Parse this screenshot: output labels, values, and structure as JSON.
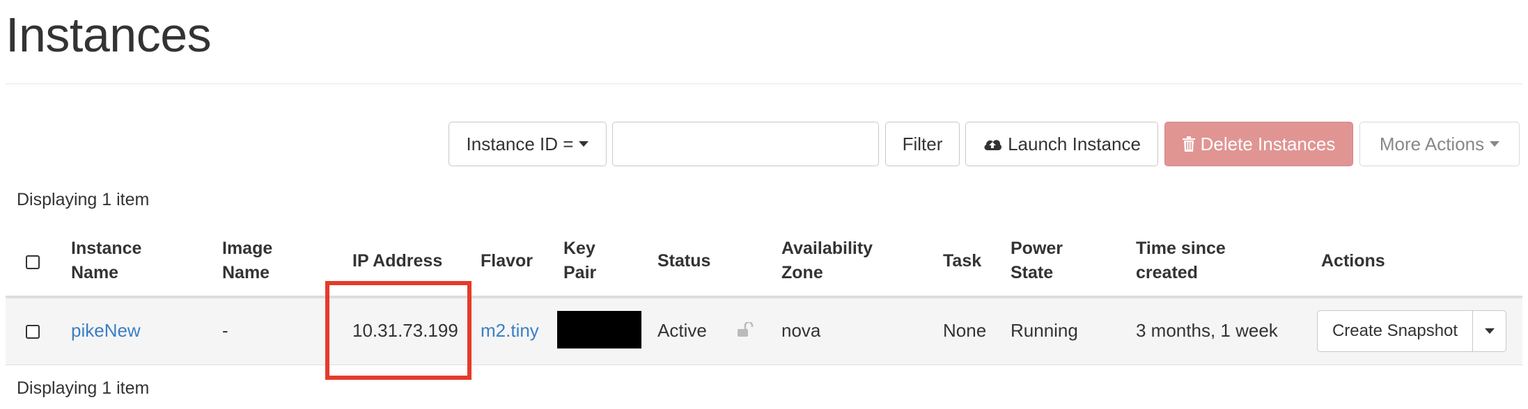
{
  "page": {
    "title": "Instances"
  },
  "toolbar": {
    "filter_field": "Instance ID =",
    "filter_value": "",
    "filter_label": "Filter",
    "launch_label": "Launch Instance",
    "delete_label": "Delete Instances",
    "more_label": "More Actions"
  },
  "summary": {
    "top": "Displaying 1 item",
    "bottom": "Displaying 1 item"
  },
  "table": {
    "headers": {
      "name_line1": "Instance",
      "name_line2": "Name",
      "image_line1": "Image",
      "image_line2": "Name",
      "ip": "IP Address",
      "flavor": "Flavor",
      "keypair_line1": "Key",
      "keypair_line2": "Pair",
      "status": "Status",
      "zone_line1": "Availability",
      "zone_line2": "Zone",
      "task": "Task",
      "power_line1": "Power",
      "power_line2": "State",
      "time_line1": "Time since",
      "time_line2": "created",
      "actions": "Actions"
    },
    "rows": [
      {
        "name": "pikeNew",
        "image": "-",
        "ip": "10.31.73.199",
        "flavor": "m2.tiny",
        "key_pair": "",
        "status": "Active",
        "zone": "nova",
        "task": "None",
        "power_state": "Running",
        "age": "3 months, 1 week",
        "action_label": "Create Snapshot"
      }
    ]
  },
  "icons": {
    "launch": "cloud-upload-icon",
    "delete": "trash-icon",
    "status_lock": "unlock-icon"
  },
  "colors": {
    "link": "#3b7fc4",
    "danger_button": "#e09593",
    "highlight": "#e53b2a"
  }
}
